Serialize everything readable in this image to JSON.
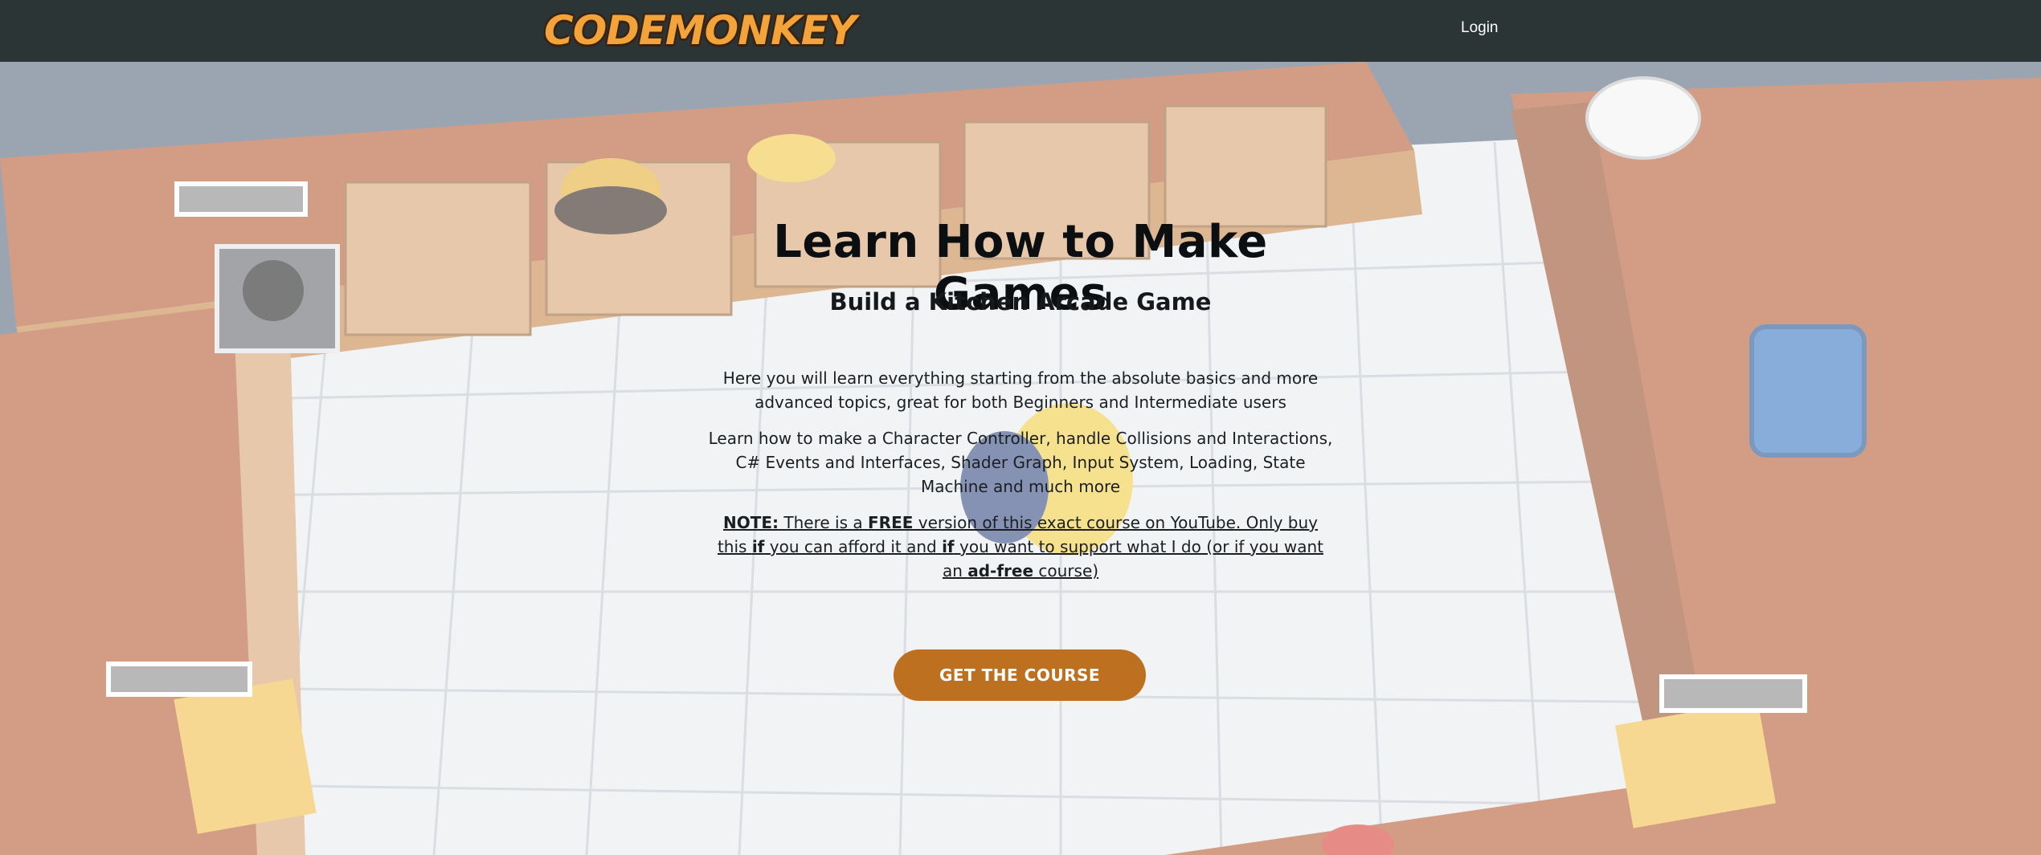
{
  "header": {
    "logo_text": "CODEMONKEY",
    "login_label": "Login"
  },
  "hero": {
    "title": "Learn How to Make Games",
    "subtitle": "Build a Kitchen Arcade Game",
    "paragraph_1": "Here you will learn everything starting from the absolute basics and more advanced topics, great for both Beginners and Intermediate users",
    "paragraph_2": "Learn how to make a Character Controller, handle Collisions and Interactions, C# Events and Interfaces, Shader Graph, Input System, Loading, State Machine and much more",
    "note": {
      "label": "NOTE:",
      "t1": " There is a ",
      "free": "FREE",
      "t2": " version of this exact course on YouTube. Only buy this ",
      "if1": "if",
      "t3": " you can afford it and ",
      "if2": "if",
      "t4": " you want to support what I do (or if you want an ",
      "adfree": "ad-free",
      "t5": " course)"
    },
    "cta_label": "GET THE COURSE"
  },
  "colors": {
    "header_bg": "#2b3535",
    "cta_bg": "#bd701f",
    "logo_orange": "#f2a33a"
  },
  "icons": {
    "logo": "monkey-head-icon"
  }
}
